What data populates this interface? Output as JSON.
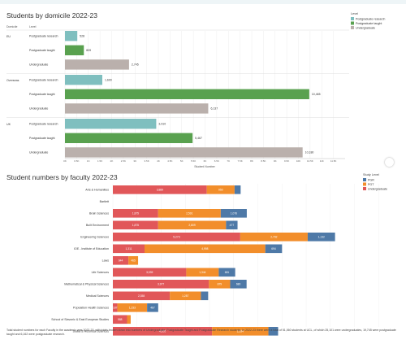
{
  "chart_data": [
    {
      "type": "bar",
      "title": "Students by domicile 2022-23",
      "row_headers": [
        "Domicile",
        "Level"
      ],
      "xlabel": "Student Number",
      "xlim": [
        0,
        12000
      ],
      "x_ticks": [
        "0K",
        "0.5K",
        "1K",
        "1.5K",
        "2K",
        "2.5K",
        "3K",
        "3.5K",
        "4K",
        "4.5K",
        "5K",
        "5.5K",
        "6K",
        "6.5K",
        "7K",
        "7.5K",
        "8K",
        "8.5K",
        "9K",
        "9.5K",
        "10K",
        "10.5K",
        "11K",
        "11.5K"
      ],
      "legend": {
        "title": "Level",
        "placement": "top-right",
        "entries": [
          "Postgraduate research",
          "Postgraduate taught",
          "Undergraduate"
        ]
      },
      "colors": {
        "Postgraduate research": "#7fbfbf",
        "Postgraduate taught": "#59a14f",
        "Undergraduate": "#bab0ac"
      },
      "groups": [
        {
          "name": "EU",
          "rows": [
            {
              "level": "Postgraduate research",
              "value": 528,
              "label": "528"
            },
            {
              "level": "Postgraduate taught",
              "value": 809,
              "label": "809"
            },
            {
              "level": "Undergraduate",
              "value": 2745,
              "label": "2,745"
            }
          ]
        },
        {
          "name": "Overseas",
          "rows": [
            {
              "level": "Postgraduate research",
              "value": 1600,
              "label": "1,600"
            },
            {
              "level": "Postgraduate taught",
              "value": 10465,
              "label": "10,465"
            },
            {
              "level": "Undergraduate",
              "value": 6137,
              "label": "6,137"
            }
          ]
        },
        {
          "name": "UK",
          "rows": [
            {
              "level": "Postgraduate research",
              "value": 3910,
              "label": "3,910"
            },
            {
              "level": "Postgraduate taught",
              "value": 5467,
              "label": "5,467"
            },
            {
              "level": "Undergraduate",
              "value": 10180,
              "label": "10,180"
            }
          ]
        }
      ]
    },
    {
      "type": "bar",
      "stacked": true,
      "title": "Student numbers by faculty 2022-23",
      "xlim": [
        0,
        12000
      ],
      "legend": {
        "title": "Study Level",
        "placement": "top-right",
        "entries": [
          "PGR",
          "PGT",
          "Undergraduate"
        ]
      },
      "colors": {
        "PGR": "#4e79a7",
        "PGT": "#f28e2b",
        "Undergraduate": "#e15759"
      },
      "categories": [
        "Arts & Humanities",
        "Bartlett",
        "Brain Sciences",
        "Built Environment",
        "Engineering Sciences",
        "IOE - Institute of Education",
        "Laws",
        "Life Sciences",
        "Mathematical & Physical Sciences",
        "Medical Sciences",
        "Population Health Sciences",
        "School of Slavonic & East European Studies",
        "Social & Historical Sciences"
      ],
      "series": [
        {
          "name": "Undergraduate",
          "values": [
            3889,
            null,
            1875,
            1875,
            5273,
            1311,
            644,
            3039,
            3977,
            2358,
            187,
            588,
            4105
          ],
          "labels": [
            "3,889",
            "",
            "1,875",
            "1,875",
            "5,273",
            "1,311",
            "644",
            "3,039",
            "3,977",
            "2,358",
            "187",
            "588",
            "4,105"
          ]
        },
        {
          "name": "PGT",
          "values": [
            1150,
            null,
            2591,
            2809,
            2792,
            4998,
            400,
            1344,
            879,
            1287,
            1229,
            150,
            2334
          ],
          "labels": [
            "950",
            "",
            "2,591",
            "2,809",
            "2,792",
            "4,998",
            "465",
            "1,344",
            "879",
            "1,287",
            "1,233",
            "",
            "2,334"
          ]
        },
        {
          "name": "PGR",
          "values": [
            250,
            null,
            1078,
            477,
            1132,
            694,
            null,
            681,
            680,
            300,
            461,
            null,
            400
          ],
          "labels": [
            "",
            "",
            "1,076",
            "477",
            "1,132",
            "694",
            "",
            "681",
            "680",
            "",
            "467",
            "",
            ""
          ]
        }
      ]
    }
  ],
  "footnote": "Total student numbers for each Faculty in the academic year 2022-23, with totals broken down into numbers of Undergraduate, Postgraduate Taught and Postgraduate Research students. In 2022-23 there were a total of 51,060 students at UCL, of which 25,101 were undergraduates, 19,745 were postgraduate taught and 6,162 were postgraduate research."
}
